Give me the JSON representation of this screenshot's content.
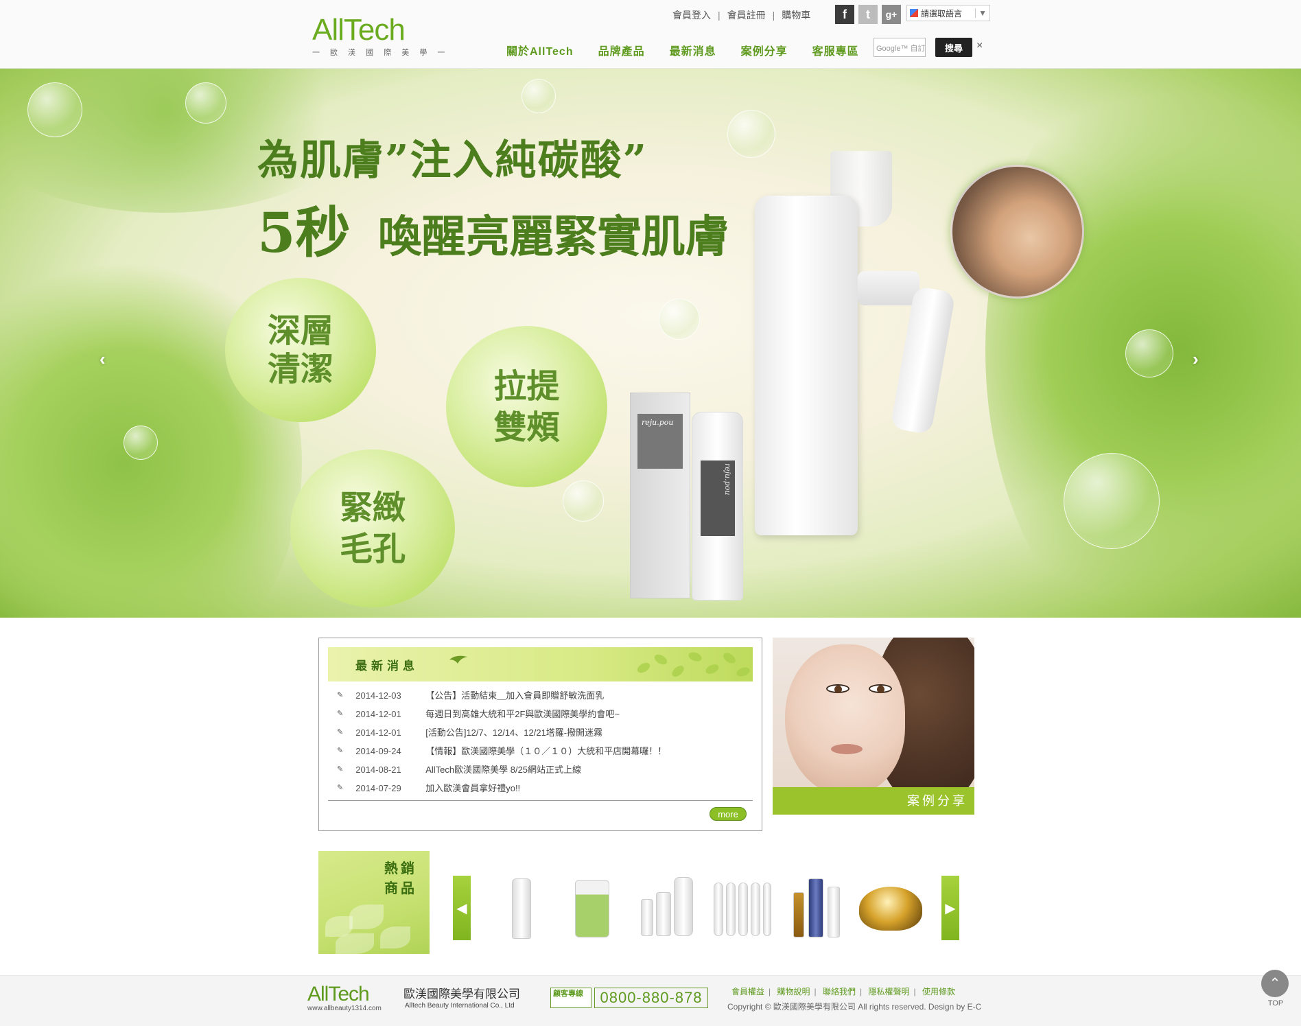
{
  "header": {
    "logo": "AllTech",
    "logo_sub": "一 歐 渼 國 際 美 學 一",
    "top_links": [
      "會員登入",
      "會員註冊",
      "購物車"
    ],
    "translate_label": "請選取語言",
    "nav": [
      "關於AllTech",
      "品牌產品",
      "最新消息",
      "案例分享",
      "客服專區"
    ],
    "search_placeholder": "Google™ 自訂搜尋",
    "search_button": "搜尋",
    "close_symbol": "×"
  },
  "banner": {
    "headline1": "為肌膚”注入純碳酸”",
    "headline2_big": "5秒",
    "headline2": "喚醒亮麗緊實肌膚",
    "circle1": [
      "深層",
      "清潔"
    ],
    "circle2": [
      "拉提",
      "雙頰"
    ],
    "circle3": [
      "緊緻",
      "毛孔"
    ],
    "product_brand": "reju.pou",
    "slide_count": 3,
    "active_slide": 1
  },
  "news": {
    "title": "最新消息",
    "items": [
      {
        "date": "2014-12-03",
        "text": "【公告】活動結束＿加入會員即贈舒敏洗面乳"
      },
      {
        "date": "2014-12-01",
        "text": "每週日到高雄大統和平2F與歐渼國際美學約會吧~"
      },
      {
        "date": "2014-12-01",
        "text": "[活動公告]12/7、12/14、12/21塔羅-撥開迷霧"
      },
      {
        "date": "2014-09-24",
        "text": "【情報】歐渼國際美學（１０／１０）大統和平店開幕囉！！"
      },
      {
        "date": "2014-08-21",
        "text": "AllTech歐渼國際美學 8/25網站正式上線"
      },
      {
        "date": "2014-07-29",
        "text": "加入歐渼會員拿好禮yo!!"
      }
    ],
    "more": "more"
  },
  "case_share": {
    "label": "案例分享"
  },
  "hot_products": {
    "title_line1": "熱銷",
    "title_line2": "商品"
  },
  "footer": {
    "logo": "AllTech",
    "url": "www.allbeauty1314.com",
    "company": "歐渼國際美學有限公司",
    "company_en": "Alltech Beauty International Co., Ltd",
    "hotline_label": "顧客專線",
    "phone": "0800-880-878",
    "links": [
      "會員權益",
      "購物說明",
      "聯絡我們",
      "隱私權聲明",
      "使用條款"
    ],
    "copyright": "Copyright © 歐渼國際美學有限公司 All rights reserved. Design by E-C"
  },
  "to_top": "TOP",
  "colors": {
    "brand_green": "#6aab1f",
    "nav_green": "#5e9a1e",
    "case_bar": "#9bc32b"
  }
}
